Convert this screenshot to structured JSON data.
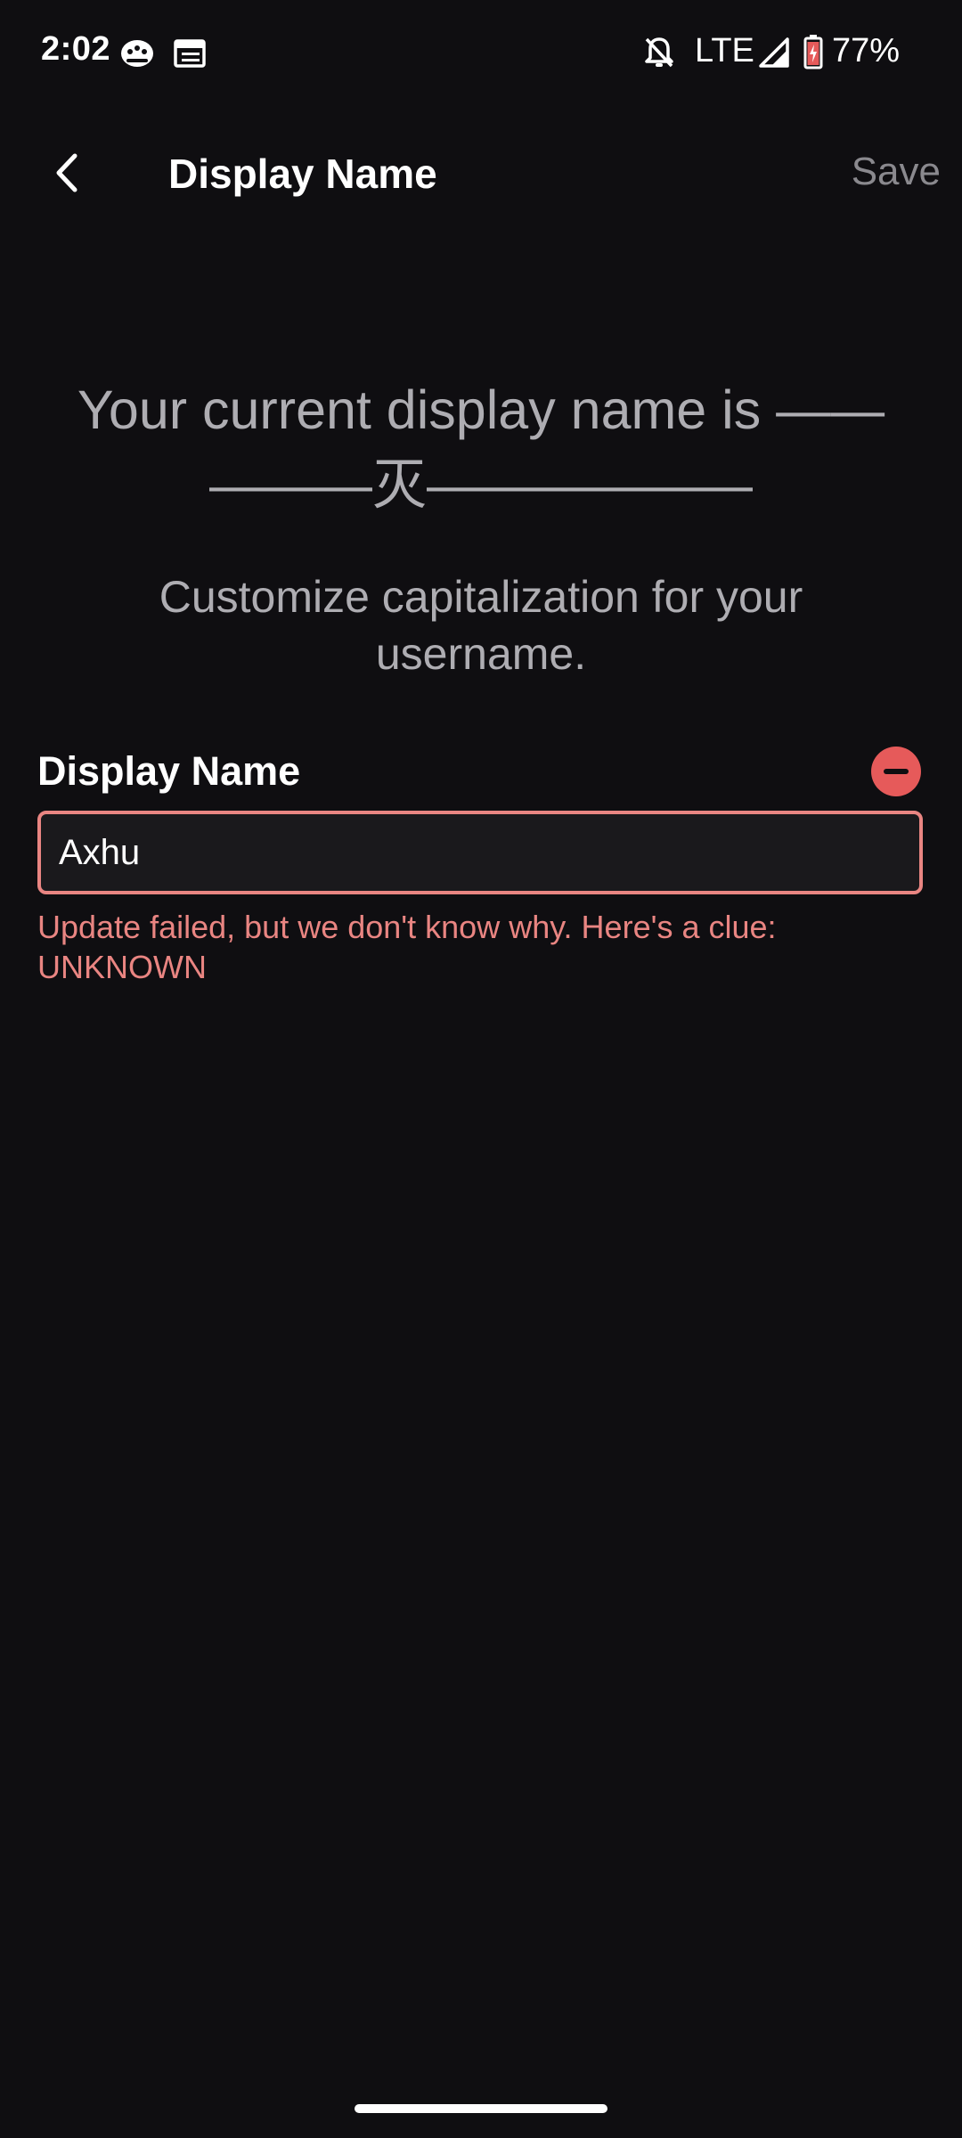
{
  "status_bar": {
    "time": "2:02",
    "network": "LTE",
    "battery": "77%",
    "icons": [
      "game-controller-icon",
      "calendar-icon",
      "bell-off-icon",
      "signal-icon",
      "battery-icon"
    ]
  },
  "app_bar": {
    "title": "Display Name",
    "save_label": "Save",
    "back_icon": "chevron-left-icon"
  },
  "main": {
    "headline_line1": "Your current display name is ——",
    "headline_line2": "———灭——————",
    "subtitle": "Customize capitalization for your username.",
    "field_label": "Display Name",
    "field_value": "Axhu",
    "error_line1": "Update failed, but we don't know why. Here's a clue:",
    "error_line2": "UNKNOWN"
  },
  "colors": {
    "background": "#0f0e11",
    "error": "#e98582",
    "error_icon": "#e65a5a",
    "muted_text": "#aeadb2",
    "save_disabled": "#8a898e"
  }
}
